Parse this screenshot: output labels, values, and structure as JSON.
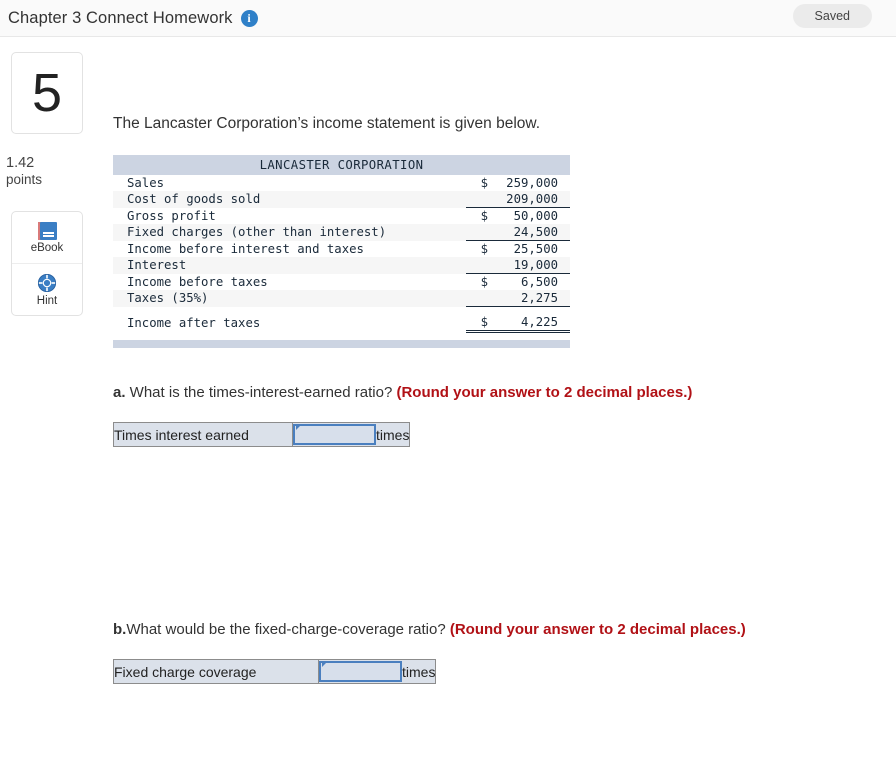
{
  "header": {
    "title": "Chapter 3 Connect Homework",
    "info_icon": "info-icon",
    "saved_label": "Saved"
  },
  "sidebar": {
    "question_number": "5",
    "points_value": "1.42",
    "points_label": "points",
    "tools": [
      {
        "icon": "book-icon",
        "label": "eBook"
      },
      {
        "icon": "life-ring-icon",
        "label": "Hint"
      }
    ]
  },
  "main": {
    "prompt": "The Lancaster Corporation’s income statement is given below.",
    "statement": {
      "title": "LANCASTER CORPORATION",
      "rows": [
        {
          "label": "Sales",
          "currency": "$",
          "amount": "259,000",
          "rule": "none",
          "shaded": false
        },
        {
          "label": "Cost of goods sold",
          "currency": "",
          "amount": "209,000",
          "rule": "single",
          "shaded": true
        },
        {
          "label": "Gross profit",
          "currency": "$",
          "amount": "50,000",
          "rule": "none",
          "shaded": false
        },
        {
          "label": "Fixed charges (other than interest)",
          "currency": "",
          "amount": "24,500",
          "rule": "single",
          "shaded": true
        },
        {
          "label": "Income before interest and taxes",
          "currency": "$",
          "amount": "25,500",
          "rule": "none",
          "shaded": false
        },
        {
          "label": "Interest",
          "currency": "",
          "amount": "19,000",
          "rule": "single",
          "shaded": true
        },
        {
          "label": "Income before taxes",
          "currency": "$",
          "amount": "6,500",
          "rule": "none",
          "shaded": false
        },
        {
          "label": "Taxes (35%)",
          "currency": "",
          "amount": "2,275",
          "rule": "single",
          "shaded": true
        },
        {
          "label": "Income after taxes",
          "currency": "$",
          "amount": "4,225",
          "rule": "double",
          "shaded": false
        }
      ]
    },
    "questions": [
      {
        "label": "a.",
        "text": " What is the times-interest-earned ratio? ",
        "note": "(Round your answer to 2 decimal places.)",
        "answer_label": "Times interest earned",
        "answer_value": "",
        "answer_placeholder": "",
        "unit": "times"
      },
      {
        "label": "b.",
        "text": "What would be the fixed-charge-coverage ratio? ",
        "note": "(Round your answer to 2 decimal places.)",
        "answer_label": "Fixed charge coverage",
        "answer_value": "",
        "answer_placeholder": "",
        "unit": "times"
      }
    ]
  },
  "colors": {
    "accent_blue": "#2f80c8",
    "input_border": "#4a7fbf",
    "table_header": "#ccd4e2",
    "note_red": "#b11116"
  }
}
